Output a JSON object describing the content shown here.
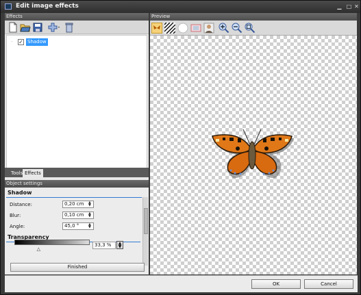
{
  "window": {
    "title": "Edit image effects"
  },
  "effects_panel": {
    "header": "Effects",
    "tree_item_label": "Shadow",
    "tree_item_checked": true,
    "tabs": [
      {
        "label": "Tools"
      },
      {
        "label": "Effects",
        "active": true
      }
    ]
  },
  "settings_panel": {
    "header": "Object settings",
    "shadow_title": "Shadow",
    "fields": [
      {
        "label": "Distance:",
        "value": "0,20 cm"
      },
      {
        "label": "Blur:",
        "value": "0,10 cm"
      },
      {
        "label": "Angle:",
        "value": "45,0 °"
      }
    ],
    "transparency_title": "Transparency",
    "transparency_value": "33,3 %",
    "transparency_fraction": 0.333,
    "finished_label": "Finished"
  },
  "preview": {
    "header": "Preview"
  },
  "buttons": {
    "ok": "OK",
    "cancel": "Cancel"
  },
  "icons": {
    "toolbar_left": [
      "new-icon",
      "open-icon",
      "save-icon",
      "add-effect-icon",
      "delete-icon"
    ],
    "toolbar_preview": [
      "butterfly-bg-icon",
      "zebra-bg-icon",
      "white-bg-icon",
      "frame-bg-icon",
      "portrait-bg-icon",
      "zoom-in-icon",
      "zoom-out-icon",
      "zoom-fit-icon"
    ]
  },
  "colors": {
    "accent": "#3399ff",
    "section_line": "#2f7ad0",
    "window_bg": "#3a3a3a"
  }
}
